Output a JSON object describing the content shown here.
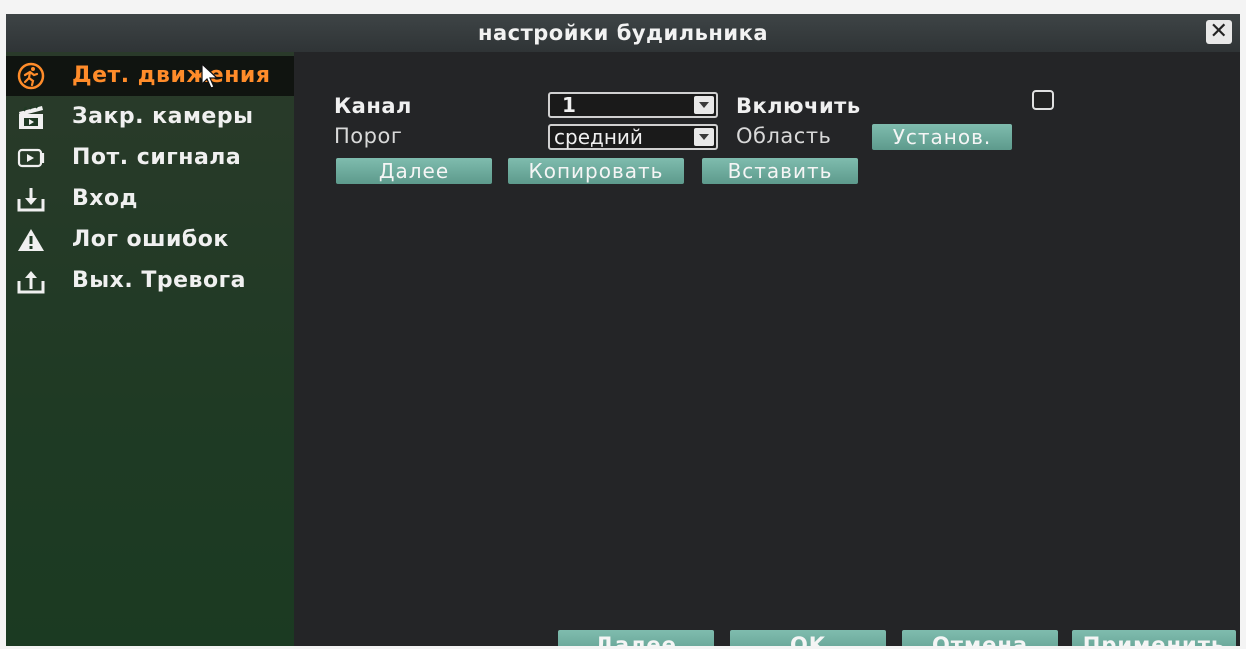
{
  "window": {
    "title": "настройки будильника"
  },
  "sidebar": {
    "items": [
      {
        "label": "Дет. движения",
        "icon": "running-man-icon",
        "active": true
      },
      {
        "label": "Закр. камеры",
        "icon": "clapperboard-icon",
        "active": false
      },
      {
        "label": "Пот. сигнала",
        "icon": "video-play-icon",
        "active": false
      },
      {
        "label": "Вход",
        "icon": "download-tray-icon",
        "active": false
      },
      {
        "label": "Лог ошибок",
        "icon": "warning-icon",
        "active": false
      },
      {
        "label": "Вых. Тревога",
        "icon": "upload-tray-icon",
        "active": false
      }
    ]
  },
  "form": {
    "channel_label": "Канал",
    "channel_value": "1",
    "enable_label": "Включить",
    "enable_checked": false,
    "threshold_label": "Порог",
    "threshold_value": "средний",
    "area_label": "Область",
    "area_button": "Установ.",
    "next_button": "Далее",
    "copy_button": "Копировать",
    "paste_button": "Вставить"
  },
  "footer": {
    "next": "Далее",
    "ok": "OK",
    "cancel": "Отмена",
    "apply": "Применить"
  },
  "colors": {
    "accent_active": "#ff8c2a",
    "button": "#6fae9f",
    "sidebar": "#1f3a24",
    "background": "#242527"
  }
}
